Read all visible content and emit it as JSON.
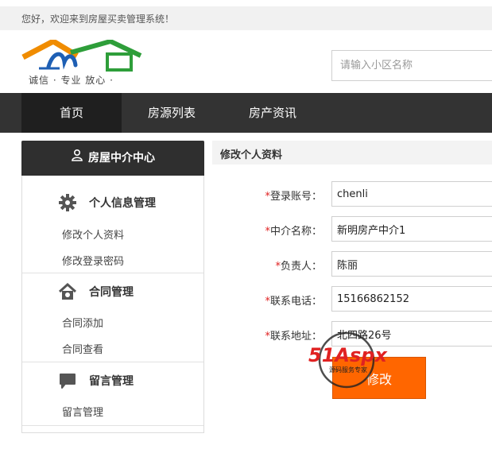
{
  "topbar": {
    "greeting": "您好，欢迎来到房屋买卖管理系统！"
  },
  "logo": {
    "slogan": "诚信 · 专业   放心 ·"
  },
  "search": {
    "placeholder": "请输入小区名称"
  },
  "nav": {
    "items": [
      {
        "label": "首页"
      },
      {
        "label": "房源列表"
      },
      {
        "label": "房产资讯"
      }
    ]
  },
  "sidebar": {
    "title": "房屋中介中心",
    "groups": [
      {
        "title": "个人信息管理",
        "links": [
          "修改个人资料",
          "修改登录密码"
        ]
      },
      {
        "title": "合同管理",
        "links": [
          "合同添加",
          "合同查看"
        ]
      },
      {
        "title": "留言管理",
        "links": [
          "留言管理"
        ]
      }
    ]
  },
  "form": {
    "heading": "修改个人资料",
    "fields": [
      {
        "label": "登录账号：",
        "value": "chenli"
      },
      {
        "label": "中介名称：",
        "value": "新明房产中介1"
      },
      {
        "label": "负责人：",
        "value": "陈丽"
      },
      {
        "label": "联系电话：",
        "value": "15166862152"
      },
      {
        "label": "联系地址：",
        "value": "北四路26号"
      }
    ],
    "required_mark": "*",
    "submit_label": "修改"
  },
  "watermark": {
    "brand": "51Aspx",
    "tagline": "源码服务专家"
  },
  "colors": {
    "nav_bg": "#333333",
    "accent": "#ff6600",
    "required": "#e02020",
    "logo_orange": "#f08c00",
    "logo_green": "#2e9e3a",
    "logo_blue": "#1e5fb4"
  }
}
